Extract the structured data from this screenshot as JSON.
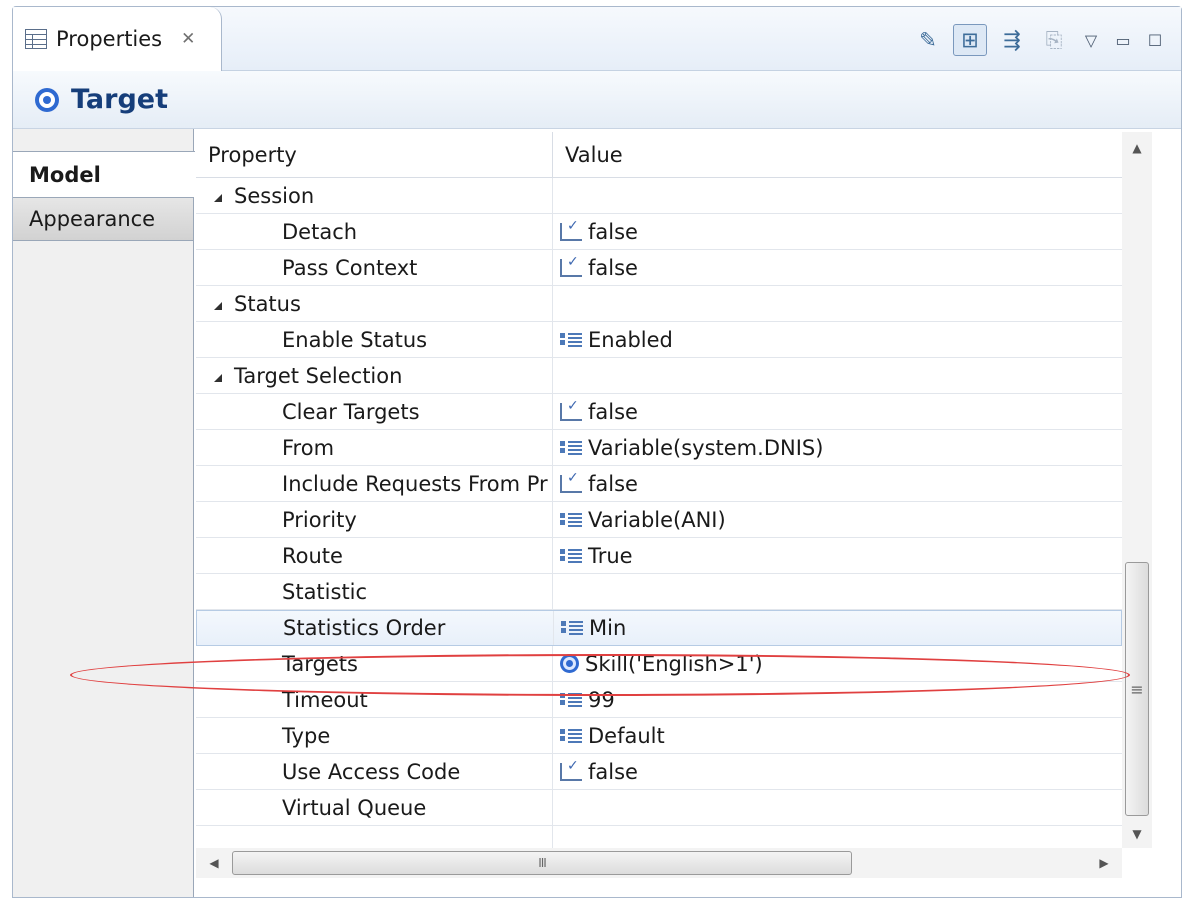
{
  "view": {
    "tab_title": "Properties",
    "close_glyph": "✕",
    "toolbar": [
      {
        "name": "pin-editor-icon",
        "glyph": "✎",
        "active": false,
        "dim": false
      },
      {
        "name": "show-categories-icon",
        "glyph": "⊞",
        "active": true,
        "dim": false
      },
      {
        "name": "show-advanced-icon",
        "glyph": "⇶",
        "active": false,
        "dim": false
      },
      {
        "name": "restore-default-icon",
        "glyph": "⎘",
        "active": false,
        "dim": true
      }
    ],
    "menu_glyph": "▽",
    "minimize_glyph": "▭",
    "maximize_glyph": "☐"
  },
  "header": {
    "title": "Target"
  },
  "side_tabs": {
    "model": "Model",
    "appearance": "Appearance"
  },
  "table": {
    "col_property": "Property",
    "col_value": "Value",
    "rows": [
      {
        "kind": "group",
        "label": "Session",
        "value": "",
        "icon": ""
      },
      {
        "kind": "prop",
        "label": "Detach",
        "value": "false",
        "icon": "bool"
      },
      {
        "kind": "prop",
        "label": "Pass Context",
        "value": "false",
        "icon": "bool"
      },
      {
        "kind": "group",
        "label": "Status",
        "value": "",
        "icon": ""
      },
      {
        "kind": "prop",
        "label": "Enable Status",
        "value": "Enabled",
        "icon": "list"
      },
      {
        "kind": "group",
        "label": "Target Selection",
        "value": "",
        "icon": ""
      },
      {
        "kind": "prop",
        "label": "Clear Targets",
        "value": "false",
        "icon": "bool"
      },
      {
        "kind": "prop",
        "label": "From",
        "value": "Variable(system.DNIS)",
        "icon": "list"
      },
      {
        "kind": "prop",
        "label": "Include Requests From Pr",
        "value": "false",
        "icon": "bool"
      },
      {
        "kind": "prop",
        "label": "Priority",
        "value": "Variable(ANI)",
        "icon": "list"
      },
      {
        "kind": "prop",
        "label": "Route",
        "value": "True",
        "icon": "list"
      },
      {
        "kind": "prop",
        "label": "Statistic",
        "value": "",
        "icon": ""
      },
      {
        "kind": "prop",
        "label": "Statistics Order",
        "value": "Min",
        "icon": "list",
        "selected": true
      },
      {
        "kind": "prop",
        "label": "Targets",
        "value": "Skill('English>1')",
        "icon": "target"
      },
      {
        "kind": "prop",
        "label": "Timeout",
        "value": "99",
        "icon": "list"
      },
      {
        "kind": "prop",
        "label": "Type",
        "value": "Default",
        "icon": "list"
      },
      {
        "kind": "prop",
        "label": "Use Access Code",
        "value": "false",
        "icon": "bool"
      },
      {
        "kind": "prop",
        "label": "Virtual Queue",
        "value": "",
        "icon": ""
      }
    ]
  },
  "scrollbar": {
    "up_glyph": "▲",
    "down_glyph": "▼",
    "grip_glyph": "≡",
    "left_glyph": "◀",
    "right_glyph": "▶",
    "hgrip_glyph": "III"
  },
  "annotation_color": "#e04040"
}
